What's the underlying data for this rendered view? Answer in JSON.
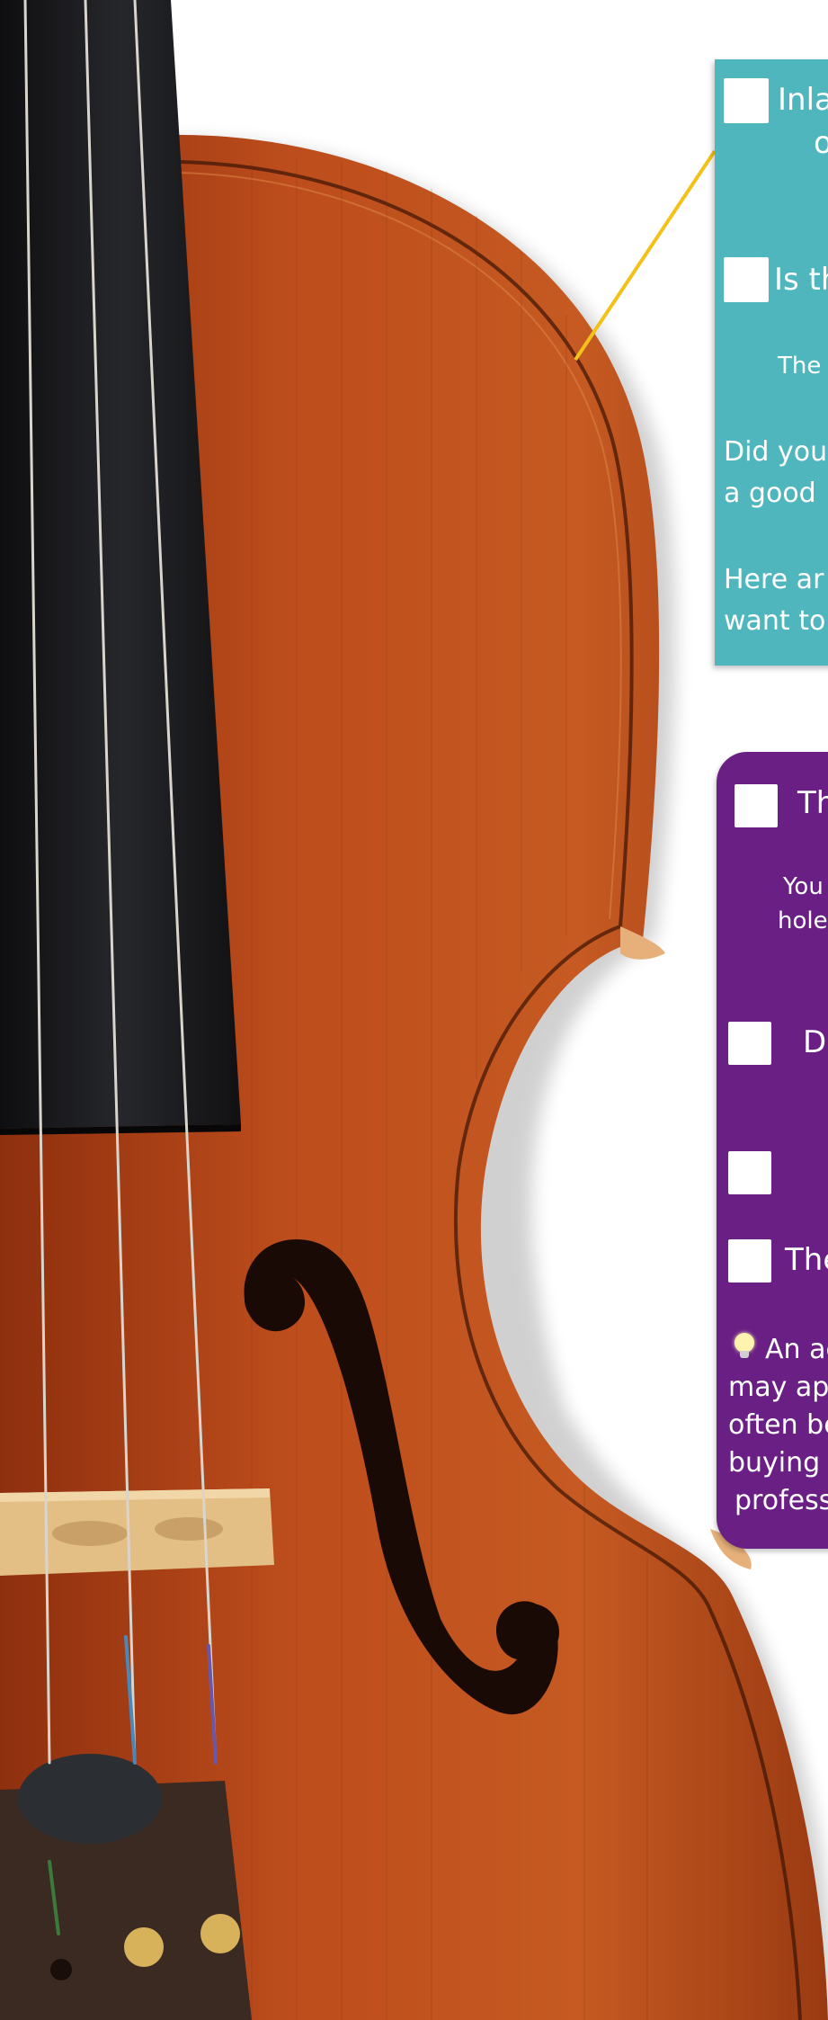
{
  "teal_panel": {
    "items": [
      {
        "line1": "Inla",
        "line2": "o"
      },
      {
        "line1": "Is th",
        "note": "The"
      }
    ],
    "paragraph1": [
      "Did you",
      "a good"
    ],
    "paragraph2": [
      "Here ar",
      "want to"
    ]
  },
  "purple_panel": {
    "items": [
      {
        "text": "Th",
        "note": [
          "You",
          "hole"
        ]
      },
      {
        "text": "De"
      },
      {
        "text": ""
      },
      {
        "text": "The"
      }
    ],
    "tip": {
      "icon": "lightbulb-icon",
      "lines": [
        "An ac",
        "may app",
        "often be",
        "buying a",
        "professi"
      ]
    }
  },
  "colors": {
    "teal": "#4fb6bd",
    "purple": "#6a1f85",
    "leader_line": "#f2c21b",
    "violin_varnish": "#b8481c",
    "fingerboard": "#1b1b1d"
  }
}
